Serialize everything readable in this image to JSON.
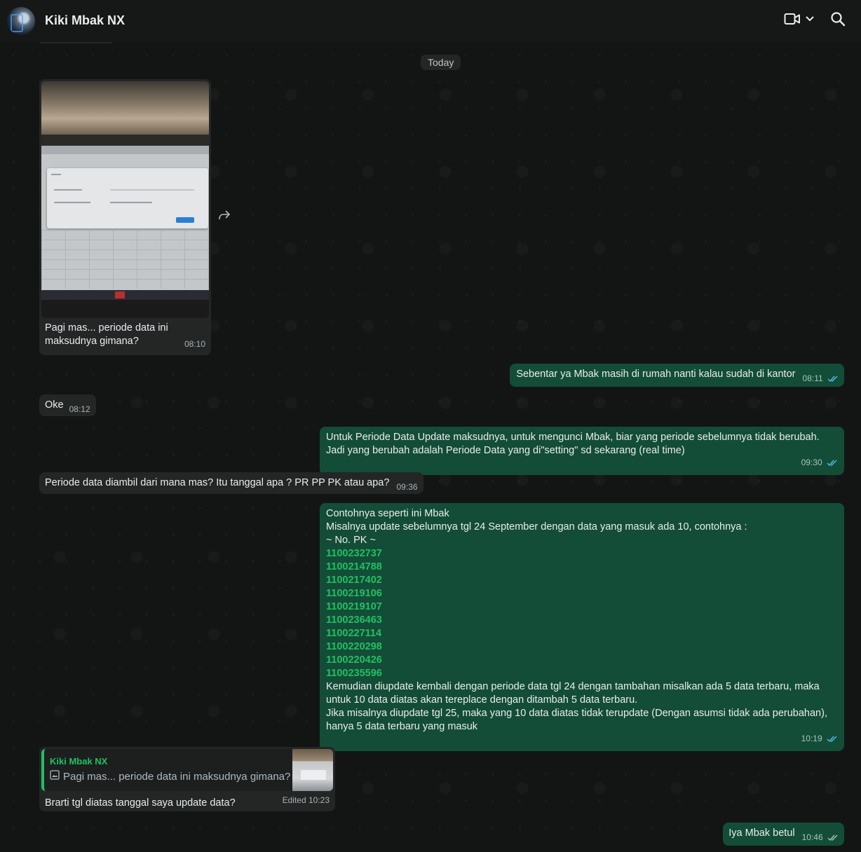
{
  "header": {
    "contact_name": "Kiki Mbak NX"
  },
  "icons": {
    "avatar": "contact-avatar",
    "video": "video-camera-icon",
    "dropdown": "chevron-down-icon",
    "search": "search-icon",
    "forward": "forward-icon",
    "ticks": "double-check-icon",
    "image": "image-icon"
  },
  "colors": {
    "incoming_bubble": "#242626",
    "outgoing_bubble": "#134d37",
    "accent_green": "#21c063",
    "read_ticks": "#53bdeb"
  },
  "chat": {
    "date_label": "Today",
    "image_message": {
      "caption": "Pagi mas... periode data ini maksudnya gimana?",
      "time": "08:10"
    },
    "messages": [
      {
        "text": "Sebentar ya Mbak masih di rumah nanti kalau sudah di kantor",
        "time": "08:11"
      },
      {
        "text": "Oke",
        "time": "08:12"
      },
      {
        "text": "Untuk Periode Data Update maksudnya, untuk mengunci Mbak, biar yang periode sebelumnya tidak berubah. Jadi yang berubah adalah Periode Data yang di\"setting\" sd sekarang (real time)",
        "time": "09:30"
      },
      {
        "text": "Periode data diambil dari mana mas? Itu tanggal apa ? PR PP PK atau apa?",
        "time": "09:36"
      }
    ],
    "example_message": {
      "line1": "Contohnya seperti ini Mbak",
      "line2": "Misalnya update sebelumnya tgl 24  September dengan data yang masuk ada 10, contohnya :",
      "line3": "~ No. PK ~",
      "pk_numbers": [
        "1100232737",
        "1100214788",
        "1100217402",
        "1100219106",
        "1100219107",
        "1100236463",
        "1100227114",
        "1100220298",
        "1100220426",
        "1100235596"
      ],
      "line4": "Kemudian diupdate kembali dengan periode data tgl 24 dengan tambahan misalkan ada 5 data terbaru, maka untuk 10 data diatas akan tereplace dengan ditambah 5 data terbaru.",
      "line5": "Jika misalnya diupdate tgl 25, maka yang 10 data diatas tidak terupdate (Dengan asumsi tidak ada perubahan), hanya 5 data terbaru yang masuk",
      "time": "10:19"
    },
    "reply_message": {
      "quoted_author": "Kiki Mbak NX",
      "quoted_text": "Pagi mas... periode data ini maksudnya gimana?",
      "text": "Brarti tgl diatas tanggal saya update data?",
      "time": "Edited 10:23"
    },
    "last_message": {
      "text": "Iya Mbak betul",
      "time": "10:46"
    }
  }
}
